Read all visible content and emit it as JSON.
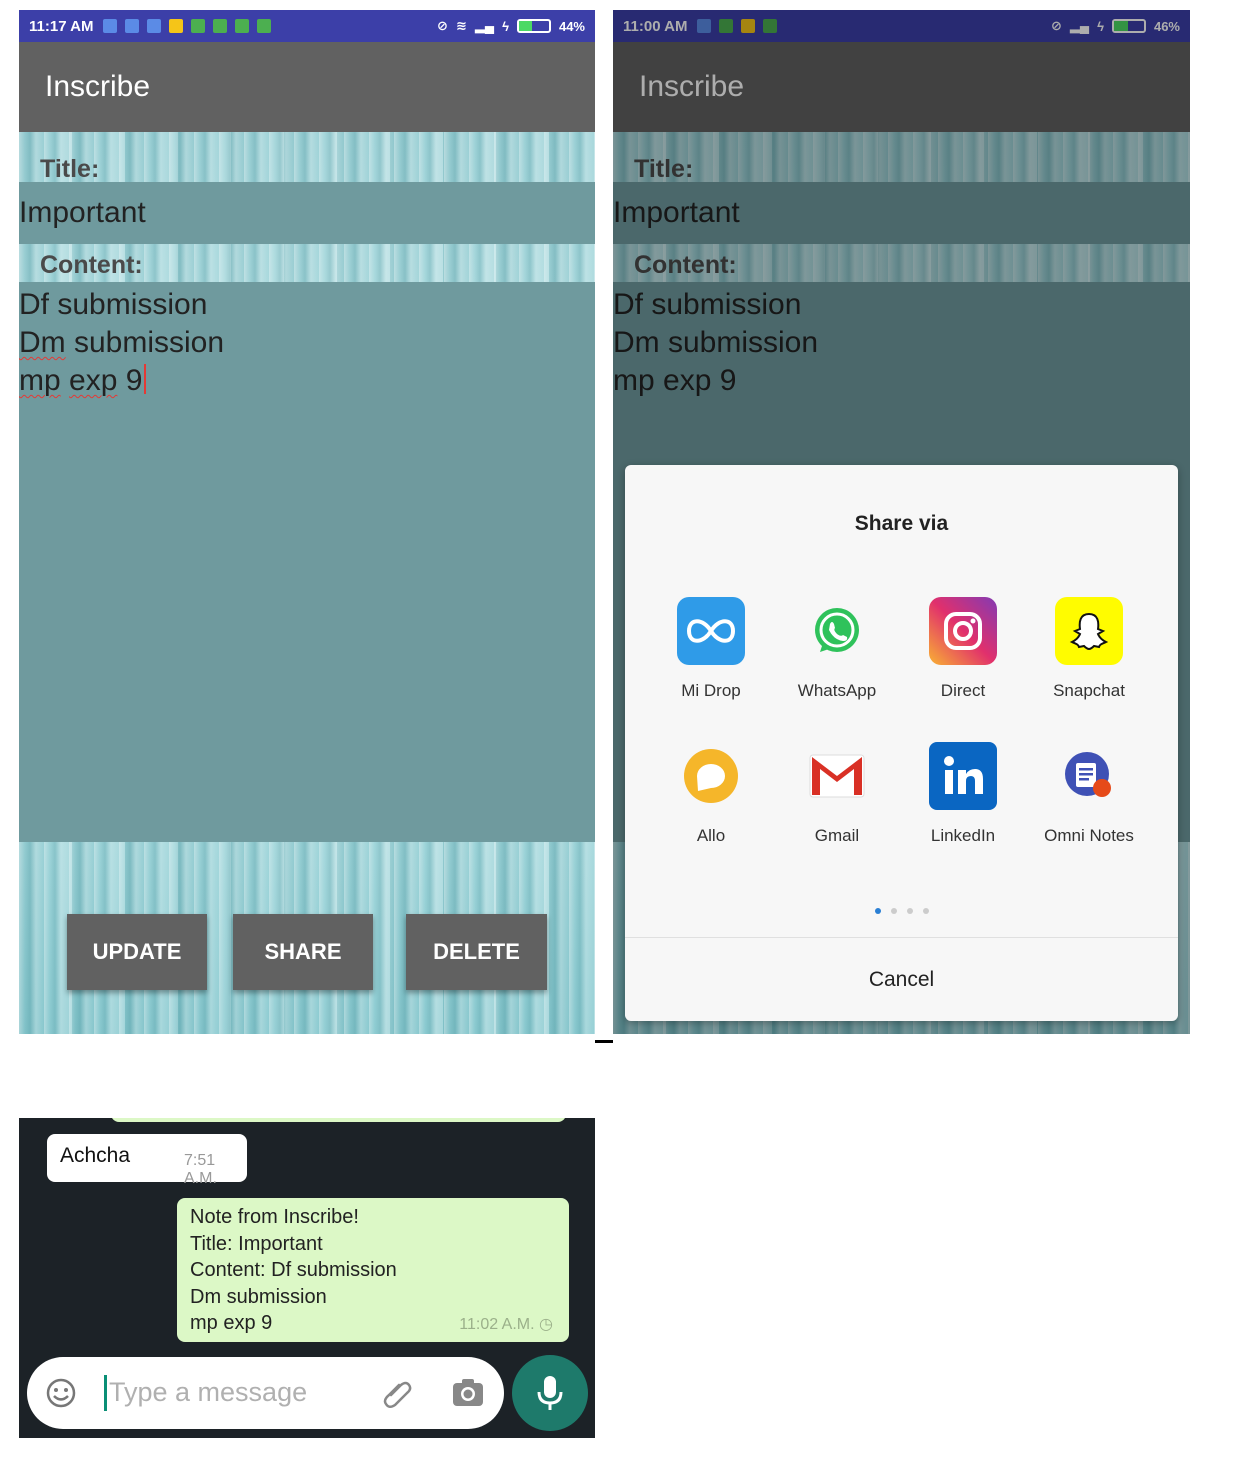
{
  "screen1": {
    "status": {
      "time": "11:17 AM",
      "battery": "44%",
      "battery_level": 0.44
    },
    "app_title": "Inscribe",
    "title_label": "Title:",
    "title_value": "Important",
    "content_label": "Content:",
    "content_lines": [
      "Df submission",
      "Dm submission",
      "mp exp 9"
    ],
    "buttons": {
      "update": "UPDATE",
      "share": "SHARE",
      "delete": "DELETE"
    }
  },
  "screen2": {
    "status": {
      "time": "11:00 AM",
      "battery": "46%",
      "battery_level": 0.46
    },
    "app_title": "Inscribe",
    "title_label": "Title:",
    "title_value": "Important",
    "content_label": "Content:",
    "content_lines": [
      "Df submission",
      "Dm submission",
      "mp exp 9"
    ],
    "share_sheet": {
      "title": "Share via",
      "apps": [
        {
          "label": "Mi Drop",
          "icon": "mi-drop-icon"
        },
        {
          "label": "WhatsApp",
          "icon": "whatsapp-icon"
        },
        {
          "label": "Direct",
          "icon": "instagram-icon"
        },
        {
          "label": "Snapchat",
          "icon": "snapchat-icon"
        },
        {
          "label": "Allo",
          "icon": "allo-icon"
        },
        {
          "label": "Gmail",
          "icon": "gmail-icon"
        },
        {
          "label": "LinkedIn",
          "icon": "linkedin-icon"
        },
        {
          "label": "Omni Notes",
          "icon": "omni-notes-icon"
        }
      ],
      "page": 1,
      "page_count": 4,
      "cancel": "Cancel"
    }
  },
  "chat": {
    "incoming": {
      "text": "Achcha",
      "time": "7:51 A.M."
    },
    "outgoing": {
      "lines": [
        "Note from Inscribe!",
        "Title: Important",
        "Content: Df submission",
        "Dm submission",
        "mp exp 9"
      ],
      "time": "11:02 A.M."
    },
    "compose_placeholder": "Type a message"
  },
  "colors": {
    "status_bar": "#3c3fa8",
    "app_bar": "#616161",
    "field_bg": "#6f9a9e",
    "bubble_out": "#dcf8c6",
    "chat_bg": "#1c2227",
    "mic": "#1e7a6b"
  }
}
